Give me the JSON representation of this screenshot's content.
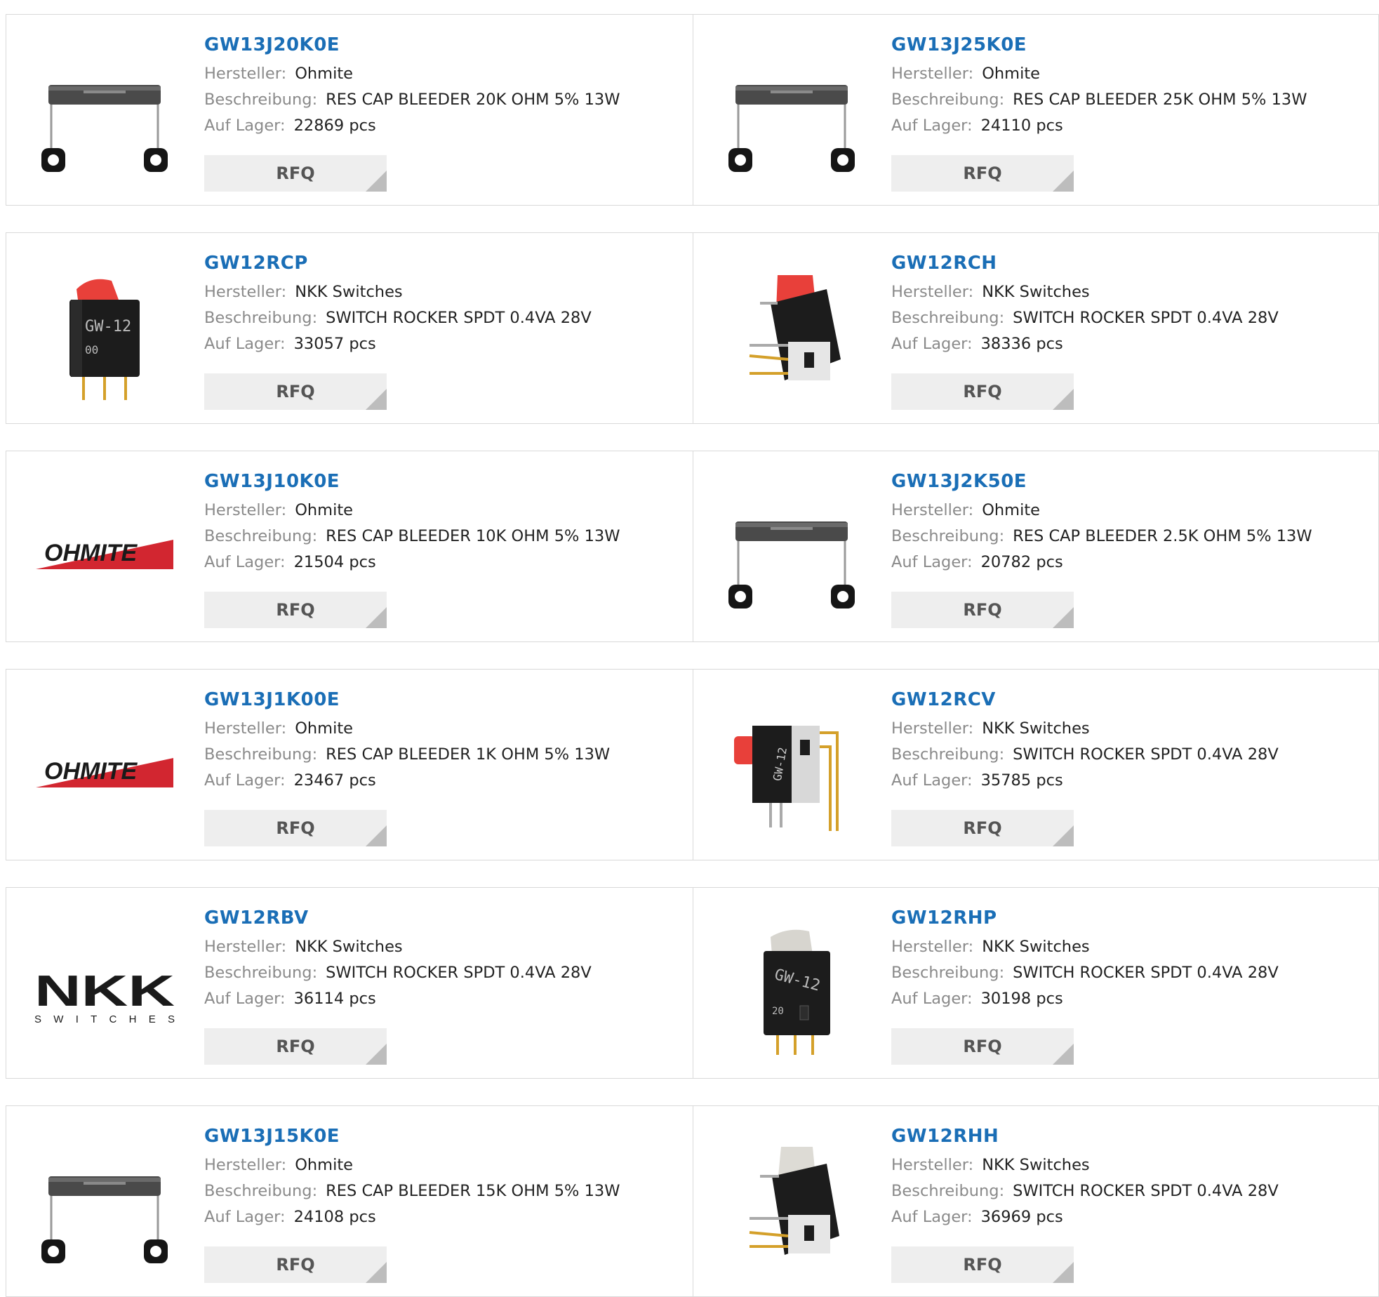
{
  "labels": {
    "manufacturer": "Hersteller:",
    "description": "Beschreibung:",
    "stock": "Auf Lager:",
    "rfq": "RFQ"
  },
  "products": [
    {
      "part": "GW13J20K0E",
      "manufacturer": "Ohmite",
      "description": "RES CAP BLEEDER 20K OHM 5% 13W",
      "stock": "22869 pcs",
      "image": "resistor-bracket-image"
    },
    {
      "part": "GW13J25K0E",
      "manufacturer": "Ohmite",
      "description": "RES CAP BLEEDER 25K OHM 5% 13W",
      "stock": "24110 pcs",
      "image": "resistor-bracket-image"
    },
    {
      "part": "GW12RCP",
      "manufacturer": "NKK Switches",
      "description": "SWITCH ROCKER SPDT 0.4VA 28V",
      "stock": "33057 pcs",
      "image": "rocker-switch-image"
    },
    {
      "part": "GW12RCH",
      "manufacturer": "NKK Switches",
      "description": "SWITCH ROCKER SPDT 0.4VA 28V",
      "stock": "38336 pcs",
      "image": "rocker-switch-side-image"
    },
    {
      "part": "GW13J10K0E",
      "manufacturer": "Ohmite",
      "description": "RES CAP BLEEDER 10K OHM 5% 13W",
      "stock": "21504 pcs",
      "image": "ohmite-logo"
    },
    {
      "part": "GW13J2K50E",
      "manufacturer": "Ohmite",
      "description": "RES CAP BLEEDER 2.5K OHM 5% 13W",
      "stock": "20782 pcs",
      "image": "resistor-bracket-image"
    },
    {
      "part": "GW13J1K00E",
      "manufacturer": "Ohmite",
      "description": "RES CAP BLEEDER 1K OHM 5% 13W",
      "stock": "23467 pcs",
      "image": "ohmite-logo"
    },
    {
      "part": "GW12RCV",
      "manufacturer": "NKK Switches",
      "description": "SWITCH ROCKER SPDT 0.4VA 28V",
      "stock": "35785 pcs",
      "image": "rocker-switch-vertical-image"
    },
    {
      "part": "GW12RBV",
      "manufacturer": "NKK Switches",
      "description": "SWITCH ROCKER SPDT 0.4VA 28V",
      "stock": "36114 pcs",
      "image": "nkk-logo"
    },
    {
      "part": "GW12RHP",
      "manufacturer": "NKK Switches",
      "description": "SWITCH ROCKER SPDT 0.4VA 28V",
      "stock": "30198 pcs",
      "image": "rocker-switch-grey-image"
    },
    {
      "part": "GW13J15K0E",
      "manufacturer": "Ohmite",
      "description": "RES CAP BLEEDER 15K OHM 5% 13W",
      "stock": "24108 pcs",
      "image": "resistor-bracket-image"
    },
    {
      "part": "GW12RHH",
      "manufacturer": "NKK Switches",
      "description": "SWITCH ROCKER SPDT 0.4VA 28V",
      "stock": "36969 pcs",
      "image": "rocker-switch-grey-side-image"
    }
  ],
  "logo_text": {
    "ohmite": "OHMITE",
    "nkk_main": "NKK",
    "nkk_sub": "SWITCHES"
  },
  "colors": {
    "link": "#1a6eb6",
    "label": "#8a8a8a",
    "border": "#d9d9d9",
    "rfq_bg": "#eeeeee",
    "ohmite_red": "#d22630",
    "switch_red": "#e8403a"
  }
}
